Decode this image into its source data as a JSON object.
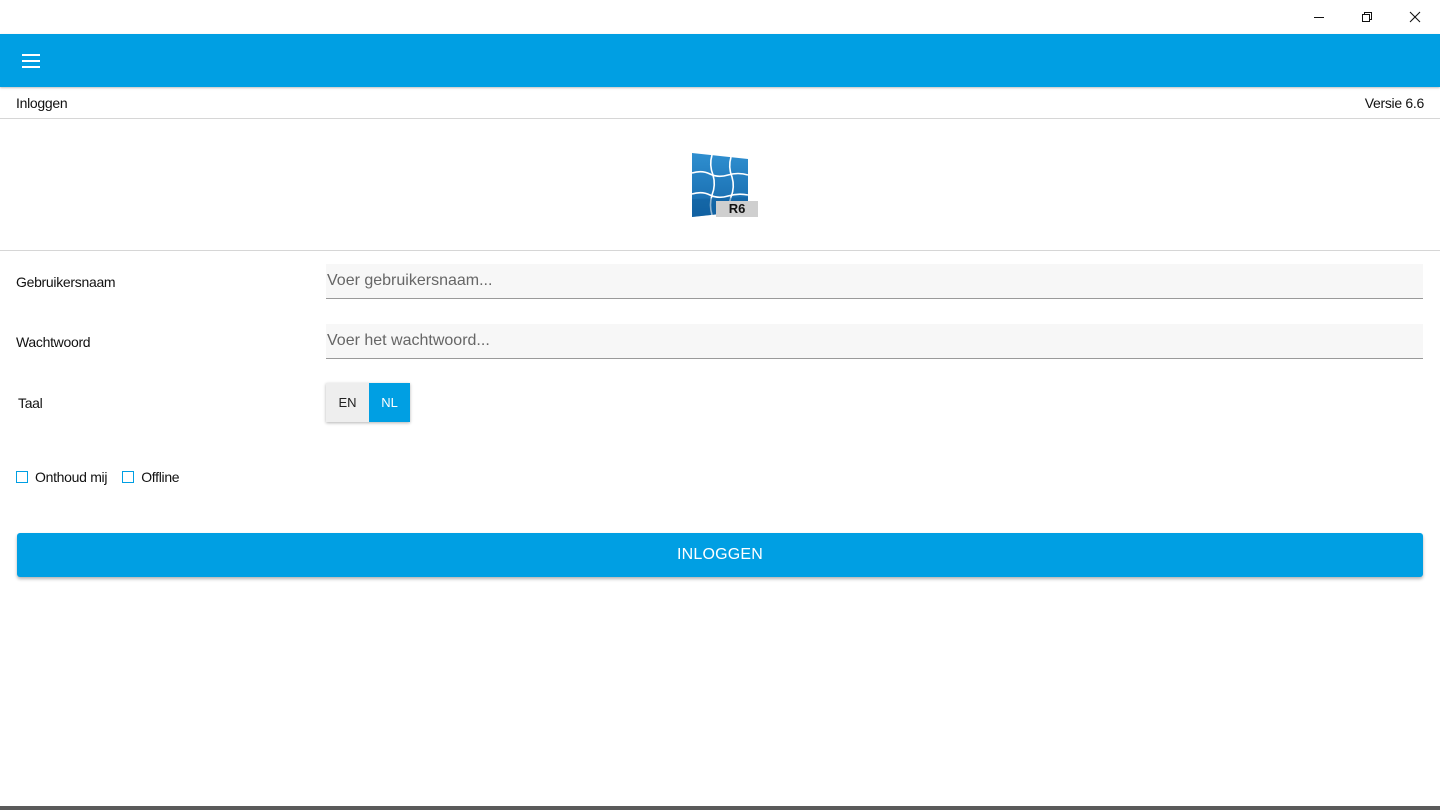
{
  "window": {
    "controls": {
      "minimize_icon": "minimize-icon",
      "maximize_icon": "restore-icon",
      "close_icon": "close-icon"
    }
  },
  "appbar": {
    "menu_icon": "hamburger-menu-icon",
    "color": "#009fe3"
  },
  "header": {
    "title": "Inloggen",
    "version": "Versie 6.6"
  },
  "logo": {
    "badge": "R6"
  },
  "form": {
    "username": {
      "label": "Gebruikersnaam",
      "placeholder": "Voer gebruikersnaam...",
      "value": ""
    },
    "password": {
      "label": "Wachtwoord",
      "placeholder": "Voer het wachtwoord...",
      "value": ""
    },
    "language": {
      "label": "Taal",
      "options": [
        "EN",
        "NL"
      ],
      "selected": "NL"
    },
    "remember_me": {
      "label": "Onthoud mij",
      "checked": false
    },
    "offline": {
      "label": "Offline",
      "checked": false
    },
    "submit_label": "INLOGGEN"
  }
}
